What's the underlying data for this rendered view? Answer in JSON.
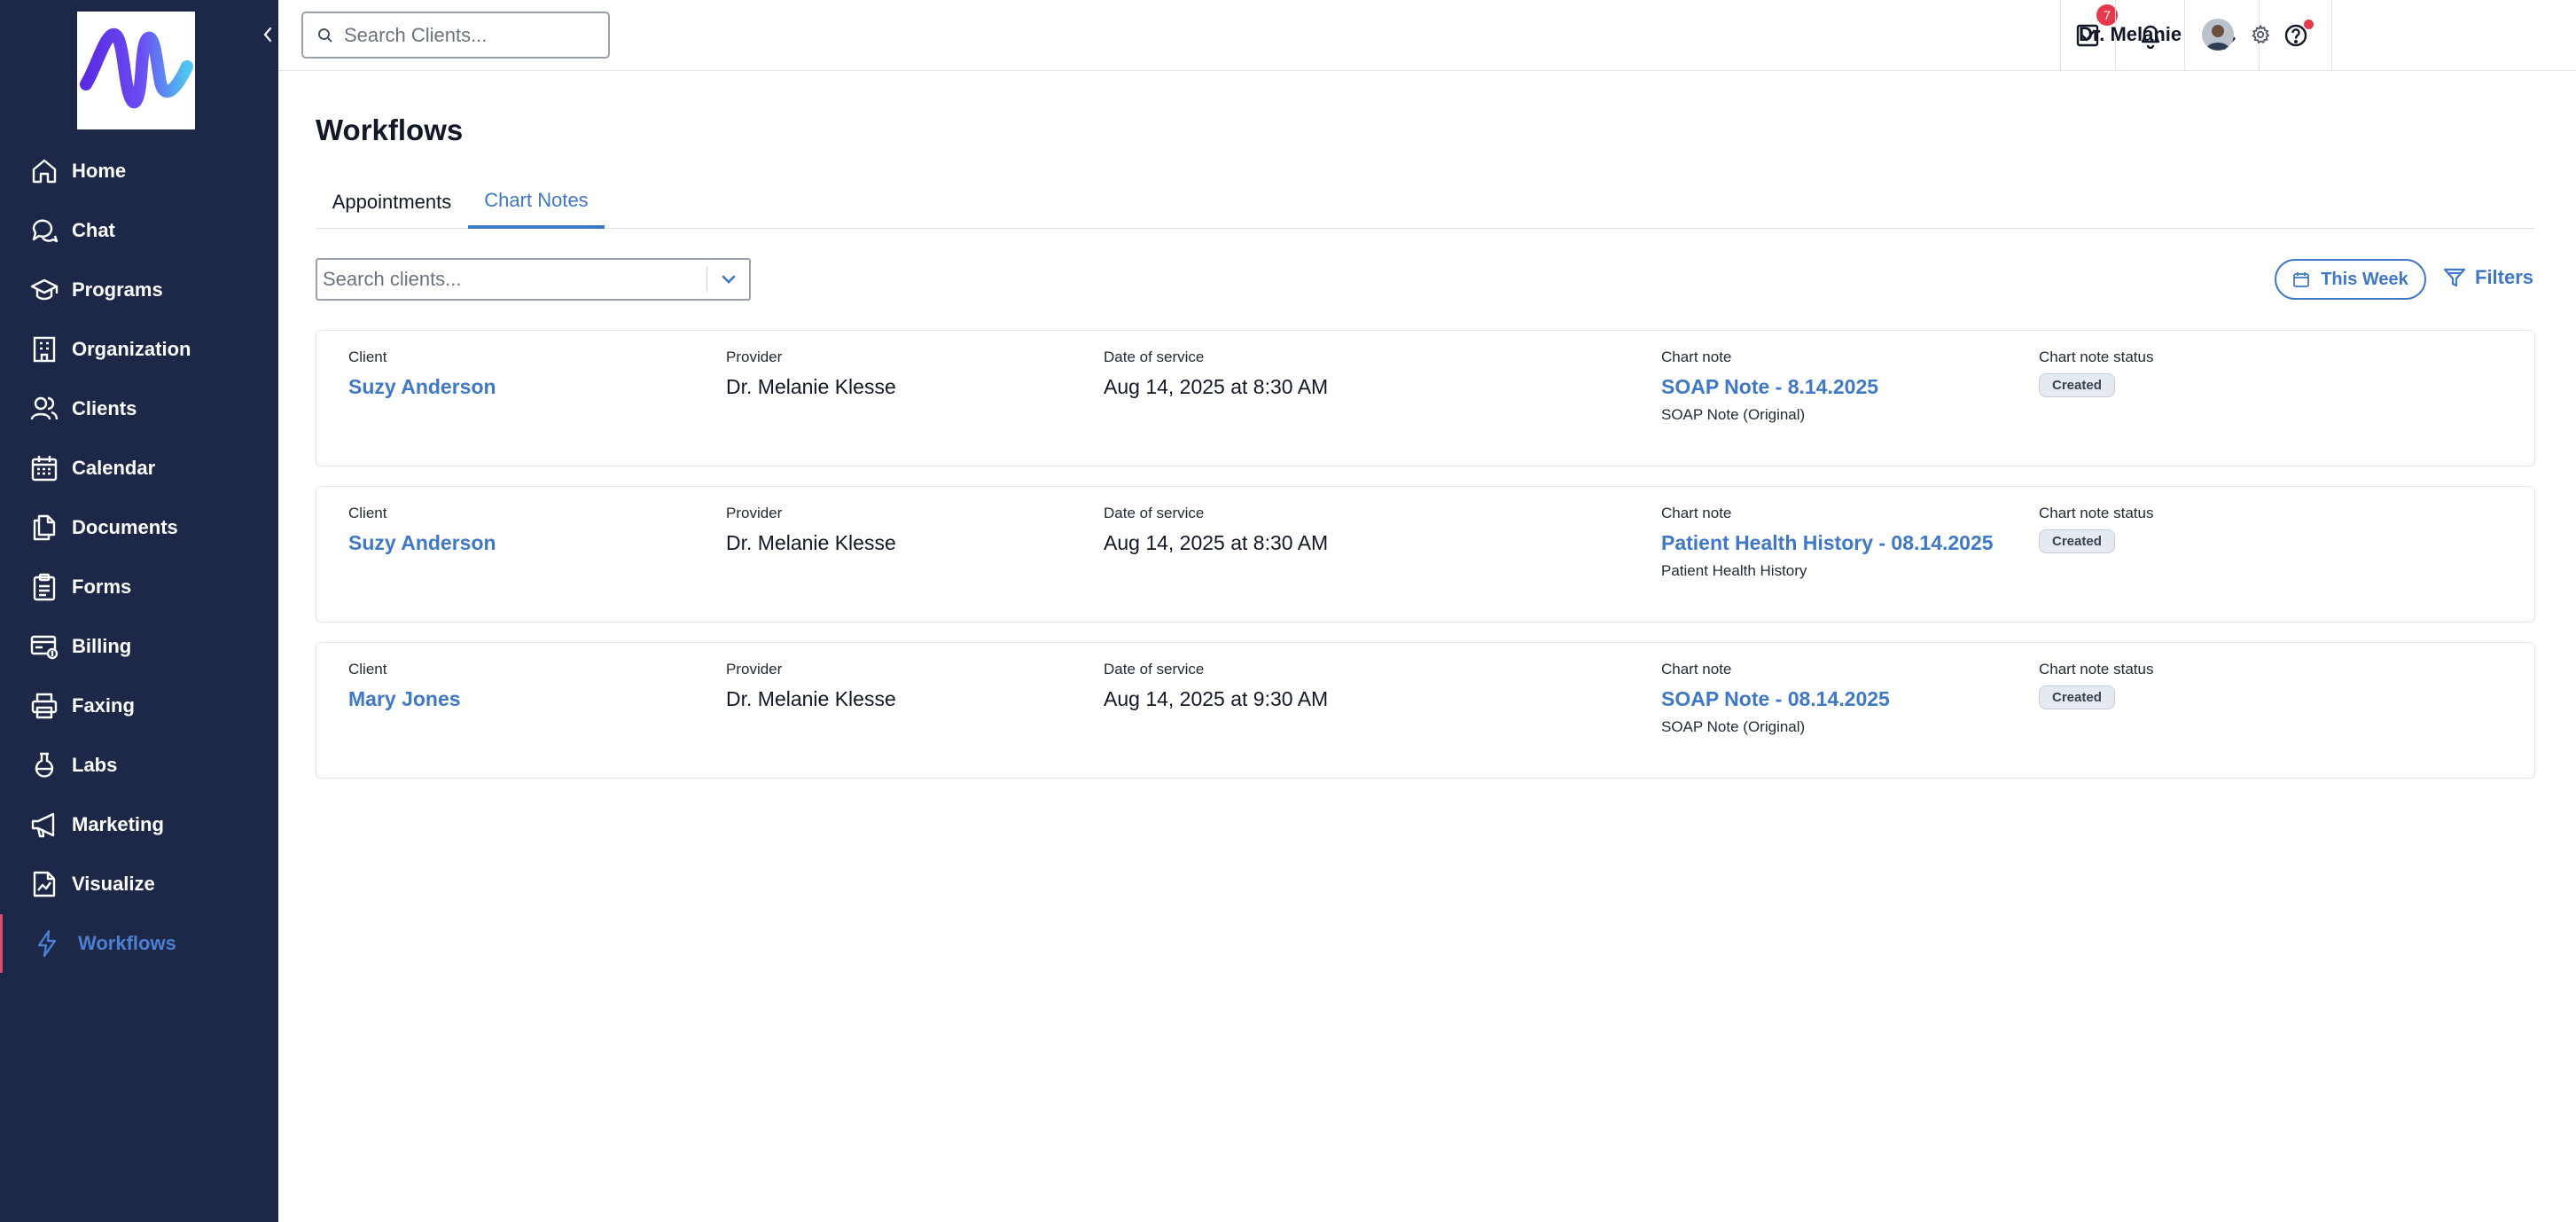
{
  "sidebar": {
    "collapse_icon": "chevron-left-icon",
    "items": [
      {
        "label": "Home",
        "icon": "home-icon"
      },
      {
        "label": "Chat",
        "icon": "chat-icon"
      },
      {
        "label": "Programs",
        "icon": "graduation-cap-icon"
      },
      {
        "label": "Organization",
        "icon": "building-icon"
      },
      {
        "label": "Clients",
        "icon": "users-icon"
      },
      {
        "label": "Calendar",
        "icon": "calendar-icon"
      },
      {
        "label": "Documents",
        "icon": "documents-icon"
      },
      {
        "label": "Forms",
        "icon": "clipboard-icon"
      },
      {
        "label": "Billing",
        "icon": "billing-icon"
      },
      {
        "label": "Faxing",
        "icon": "printer-icon"
      },
      {
        "label": "Labs",
        "icon": "flask-icon"
      },
      {
        "label": "Marketing",
        "icon": "megaphone-icon"
      },
      {
        "label": "Visualize",
        "icon": "chart-doc-icon"
      },
      {
        "label": "Workflows",
        "icon": "lightning-icon",
        "active": true
      }
    ]
  },
  "topbar": {
    "search_placeholder": "Search Clients...",
    "tasks_count": "7",
    "user_name": "Dr. Melanie"
  },
  "page": {
    "title": "Workflows",
    "tabs": [
      {
        "label": "Appointments"
      },
      {
        "label": "Chart Notes",
        "active": true
      }
    ],
    "client_search_placeholder": "Search clients...",
    "week_button": "This Week",
    "filters_button": "Filters"
  },
  "columns": {
    "client": "Client",
    "provider": "Provider",
    "date": "Date of service",
    "note": "Chart note",
    "status": "Chart note status"
  },
  "rows": [
    {
      "client": "Suzy Anderson",
      "provider": "Dr. Melanie Klesse",
      "date": "Aug 14, 2025 at 8:30 AM",
      "note": "SOAP Note - 8.14.2025",
      "note_type": "SOAP Note (Original)",
      "status": "Created"
    },
    {
      "client": "Suzy Anderson",
      "provider": "Dr. Melanie Klesse",
      "date": "Aug 14, 2025 at 8:30 AM",
      "note": "Patient Health History - 08.14.2025",
      "note_type": "Patient Health History",
      "status": "Created"
    },
    {
      "client": "Mary Jones",
      "provider": "Dr. Melanie Klesse",
      "date": "Aug 14, 2025 at 9:30 AM",
      "note": "SOAP Note - 08.14.2025",
      "note_type": "SOAP Note (Original)",
      "status": "Created"
    }
  ],
  "colors": {
    "sidebar_bg": "#1d2848",
    "accent": "#3e78c7",
    "active_marker": "#e0486e",
    "badge": "#e53a4b"
  }
}
